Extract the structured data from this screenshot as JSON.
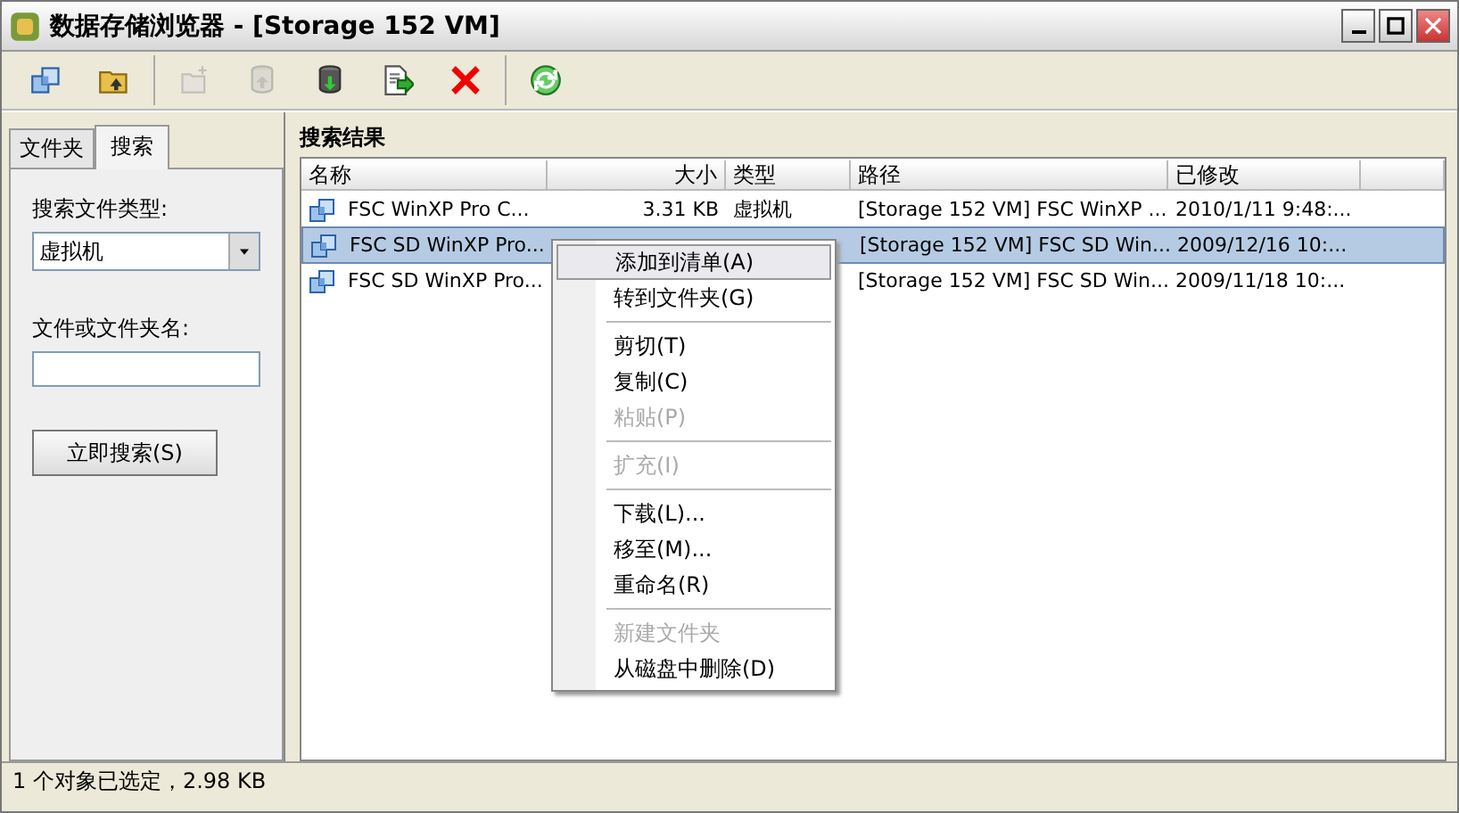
{
  "window": {
    "title": "数据存储浏览器 - [Storage 152 VM]"
  },
  "toolbar": [
    {
      "kind": "vm-copy",
      "disabled": false
    },
    {
      "kind": "folder-up",
      "disabled": false
    },
    {
      "kind": "separator"
    },
    {
      "kind": "new-folder",
      "disabled": true
    },
    {
      "kind": "upload",
      "disabled": true
    },
    {
      "kind": "download",
      "disabled": false
    },
    {
      "kind": "export",
      "disabled": false
    },
    {
      "kind": "delete",
      "disabled": false
    },
    {
      "kind": "separator"
    },
    {
      "kind": "refresh",
      "disabled": false
    }
  ],
  "side_tabs": [
    {
      "label": "文件夹",
      "selected": false
    },
    {
      "label": "搜索",
      "selected": true
    }
  ],
  "search_panel": {
    "type_label": "搜索文件类型:",
    "type_value": "虚拟机",
    "name_label": "文件或文件夹名:",
    "search_button": "立即搜索(S)"
  },
  "results": {
    "title": "搜索结果",
    "columns": [
      "名称",
      "大小",
      "类型",
      "路径",
      "已修改"
    ],
    "rows": [
      {
        "name": "FSC WinXP Pro C...",
        "size": "3.31 KB",
        "type": "虚拟机",
        "path": "[Storage 152 VM] FSC WinXP ...",
        "modified": "2010/1/11 9:48:...",
        "selected": false
      },
      {
        "name": "FSC SD WinXP Pro...",
        "size": "",
        "type": "",
        "path": "[Storage 152 VM] FSC SD Win...",
        "modified": "2009/12/16 10:...",
        "selected": true
      },
      {
        "name": "FSC SD WinXP Pro...",
        "size": "",
        "type": "",
        "path": "[Storage 152 VM] FSC SD Win...",
        "modified": "2009/11/18 10:...",
        "selected": false
      }
    ]
  },
  "context_menu": [
    {
      "kind": "item",
      "label": "添加到清单(A)",
      "disabled": false,
      "selected": true
    },
    {
      "kind": "item",
      "label": "转到文件夹(G)",
      "disabled": false,
      "selected": false
    },
    {
      "kind": "separator"
    },
    {
      "kind": "item",
      "label": "剪切(T)",
      "disabled": false,
      "selected": false
    },
    {
      "kind": "item",
      "label": "复制(C)",
      "disabled": false,
      "selected": false
    },
    {
      "kind": "item",
      "label": "粘贴(P)",
      "disabled": true,
      "selected": false
    },
    {
      "kind": "separator"
    },
    {
      "kind": "item",
      "label": "扩充(I)",
      "disabled": true,
      "selected": false
    },
    {
      "kind": "separator"
    },
    {
      "kind": "item",
      "label": "下载(L)...",
      "disabled": false,
      "selected": false
    },
    {
      "kind": "item",
      "label": "移至(M)...",
      "disabled": false,
      "selected": false
    },
    {
      "kind": "item",
      "label": "重命名(R)",
      "disabled": false,
      "selected": false
    },
    {
      "kind": "separator"
    },
    {
      "kind": "item",
      "label": "新建文件夹",
      "disabled": true,
      "selected": false
    },
    {
      "kind": "item",
      "label": "从磁盘中删除(D)",
      "disabled": false,
      "selected": false
    }
  ],
  "status_bar": "1 个对象已选定，2.98 KB"
}
